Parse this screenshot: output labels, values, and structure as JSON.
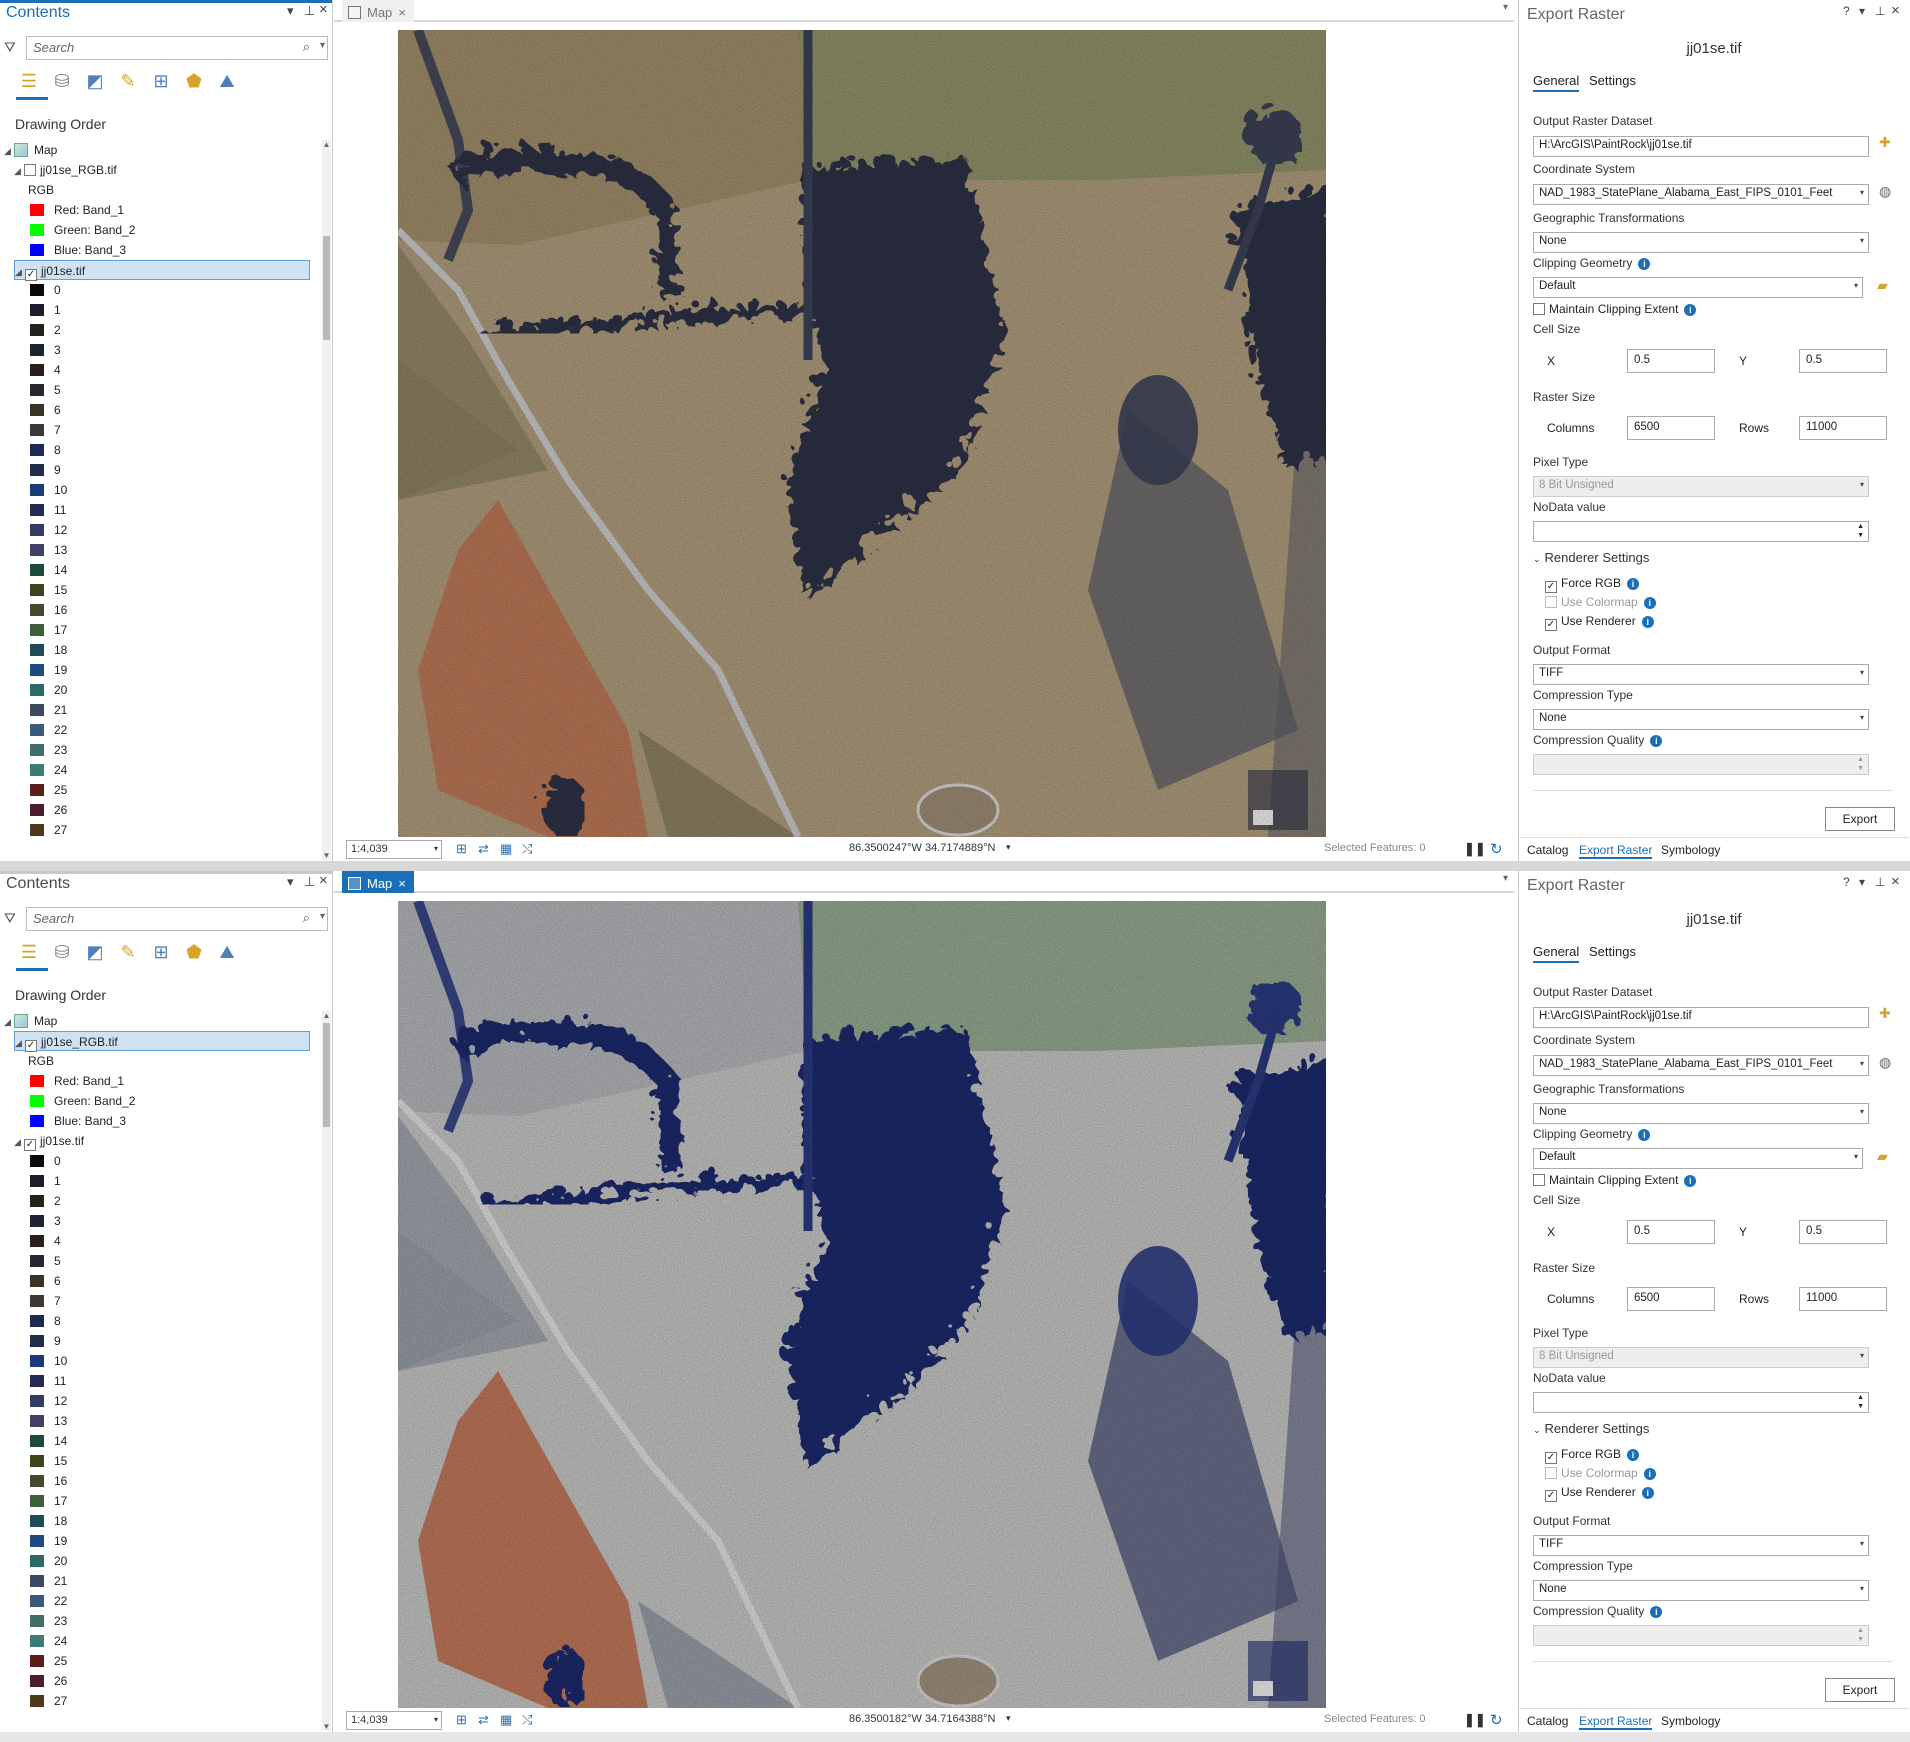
{
  "instances": [
    {
      "contents": {
        "title": "Contents",
        "title_active": true,
        "search_placeholder": "Search",
        "drawing_order": "Drawing Order",
        "map_label": "Map",
        "rgb_layer": {
          "name": "jj01se_RGB.tif",
          "checked": false,
          "selected": false
        },
        "rgb_heading": "RGB",
        "bands": [
          {
            "label": "Red:  Band_1",
            "color": "#ff0000"
          },
          {
            "label": "Green: Band_2",
            "color": "#00ff00"
          },
          {
            "label": "Blue:  Band_3",
            "color": "#0000ff"
          }
        ],
        "tif_layer": {
          "name": "jj01se.tif",
          "checked": true,
          "selected": true
        },
        "scroll_thumb": 0.12
      },
      "map": {
        "tab_label": "Map",
        "tab_active": false,
        "scale": "1:4,039",
        "coords": "86.3500247°W 34.7174889°N",
        "selected_features": "Selected Features: 0",
        "palette": {
          "field": "#b29f7f",
          "field2": "#a3906c",
          "orchard": "#8f8466",
          "trees": "#2d3146",
          "treeshade": "#3c4259",
          "dirt": "#c07a58",
          "road": "#cfcfcf",
          "pond": "#a08f78",
          "green": "#7a8a5a",
          "shadow": "#5c5f69"
        }
      },
      "export": {
        "title": "Export Raster",
        "filename": "jj01se.tif",
        "tab_general": "General",
        "tab_settings": "Settings",
        "output_label": "Output Raster Dataset",
        "output_value": "H:\\ArcGIS\\PaintRock\\jj01se.tif",
        "coord_label": "Coordinate System",
        "coord_value": "NAD_1983_StatePlane_Alabama_East_FIPS_0101_Feet",
        "geo_label": "Geographic Transformations",
        "geo_value": "None",
        "clip_label": "Clipping Geometry",
        "clip_value": "Default",
        "maintain_label": "Maintain Clipping Extent",
        "cell_label": "Cell Size",
        "x_label": "X",
        "x_value": "0.5",
        "y_label": "Y",
        "y_value": "0.5",
        "raster_label": "Raster Size",
        "columns_label": "Columns",
        "columns_value": "6500",
        "rows_label": "Rows",
        "rows_value": "11000",
        "pixel_label": "Pixel Type",
        "pixel_value": "8 Bit Unsigned",
        "nodata_label": "NoData value",
        "renderer_label": "Renderer Settings",
        "force_rgb": "Force RGB",
        "use_colormap": "Use Colormap",
        "use_renderer": "Use Renderer",
        "format_label": "Output Format",
        "format_value": "TIFF",
        "comp_type_label": "Compression Type",
        "comp_type_value": "None",
        "comp_quality_label": "Compression Quality",
        "export_button": "Export",
        "bottom_tabs": [
          "Catalog",
          "Export Raster",
          "Symbology"
        ]
      }
    },
    {
      "contents": {
        "title": "Contents",
        "title_active": false,
        "search_placeholder": "Search",
        "drawing_order": "Drawing Order",
        "map_label": "Map",
        "rgb_layer": {
          "name": "jj01se_RGB.tif",
          "checked": true,
          "selected": true
        },
        "rgb_heading": "RGB",
        "bands": [
          {
            "label": "Red:  Band_1",
            "color": "#ff0000"
          },
          {
            "label": "Green: Band_2",
            "color": "#00ff00"
          },
          {
            "label": "Blue:  Band_3",
            "color": "#0000ff"
          }
        ],
        "tif_layer": {
          "name": "jj01se.tif",
          "checked": true,
          "selected": false
        },
        "scroll_thumb": 0.0
      },
      "map": {
        "tab_label": "Map",
        "tab_active": true,
        "scale": "1:4,039",
        "coords": "86.3500182°W 34.7164388°N",
        "selected_features": "Selected Features: 0",
        "palette": {
          "field": "#c9c9c8",
          "field2": "#b7b9bd",
          "orchard": "#9aa0aa",
          "trees": "#1b2a6e",
          "treeshade": "#2a3a82",
          "dirt": "#c47a5c",
          "road": "#e4e4e4",
          "pond": "#a49480",
          "green": "#6e9468",
          "shadow": "#4a5279"
        }
      },
      "export": {
        "title": "Export Raster",
        "filename": "jj01se.tif",
        "tab_general": "General",
        "tab_settings": "Settings",
        "output_label": "Output Raster Dataset",
        "output_value": "H:\\ArcGIS\\PaintRock\\jj01se.tif",
        "coord_label": "Coordinate System",
        "coord_value": "NAD_1983_StatePlane_Alabama_East_FIPS_0101_Feet",
        "geo_label": "Geographic Transformations",
        "geo_value": "None",
        "clip_label": "Clipping Geometry",
        "clip_value": "Default",
        "maintain_label": "Maintain Clipping Extent",
        "cell_label": "Cell Size",
        "x_label": "X",
        "x_value": "0.5",
        "y_label": "Y",
        "y_value": "0.5",
        "raster_label": "Raster Size",
        "columns_label": "Columns",
        "columns_value": "6500",
        "rows_label": "Rows",
        "rows_value": "11000",
        "pixel_label": "Pixel Type",
        "pixel_value": "8 Bit Unsigned",
        "nodata_label": "NoData value",
        "renderer_label": "Renderer Settings",
        "force_rgb": "Force RGB",
        "use_colormap": "Use Colormap",
        "use_renderer": "Use Renderer",
        "format_label": "Output Format",
        "format_value": "TIFF",
        "comp_type_label": "Compression Type",
        "comp_type_value": "None",
        "comp_quality_label": "Compression Quality",
        "export_button": "Export",
        "bottom_tabs": [
          "Catalog",
          "Export Raster",
          "Symbology"
        ]
      }
    }
  ],
  "legend_classes": [
    {
      "label": "0",
      "color": "#0a0a0a"
    },
    {
      "label": "1",
      "color": "#1c1c2c"
    },
    {
      "label": "2",
      "color": "#23231a"
    },
    {
      "label": "3",
      "color": "#1e2430"
    },
    {
      "label": "4",
      "color": "#2a1f1c"
    },
    {
      "label": "5",
      "color": "#2b2530"
    },
    {
      "label": "6",
      "color": "#3a3422"
    },
    {
      "label": "7",
      "color": "#3d3833"
    },
    {
      "label": "8",
      "color": "#1a2a55"
    },
    {
      "label": "9",
      "color": "#1f2f4a"
    },
    {
      "label": "10",
      "color": "#1b3a7a"
    },
    {
      "label": "11",
      "color": "#252a55"
    },
    {
      "label": "12",
      "color": "#303c62"
    },
    {
      "label": "13",
      "color": "#404063"
    },
    {
      "label": "14",
      "color": "#1c4a3c"
    },
    {
      "label": "15",
      "color": "#3a4520"
    },
    {
      "label": "16",
      "color": "#424a2d"
    },
    {
      "label": "17",
      "color": "#3b5f3a"
    },
    {
      "label": "18",
      "color": "#1f4d55"
    },
    {
      "label": "19",
      "color": "#1d4a80"
    },
    {
      "label": "20",
      "color": "#2b6a66"
    },
    {
      "label": "21",
      "color": "#3a4a60"
    },
    {
      "label": "22",
      "color": "#3a5a7a"
    },
    {
      "label": "23",
      "color": "#3f6f68"
    },
    {
      "label": "24",
      "color": "#3d7a74"
    },
    {
      "label": "25",
      "color": "#5a1f1a"
    },
    {
      "label": "26",
      "color": "#4a1d30"
    },
    {
      "label": "27",
      "color": "#4d3a1a"
    }
  ]
}
